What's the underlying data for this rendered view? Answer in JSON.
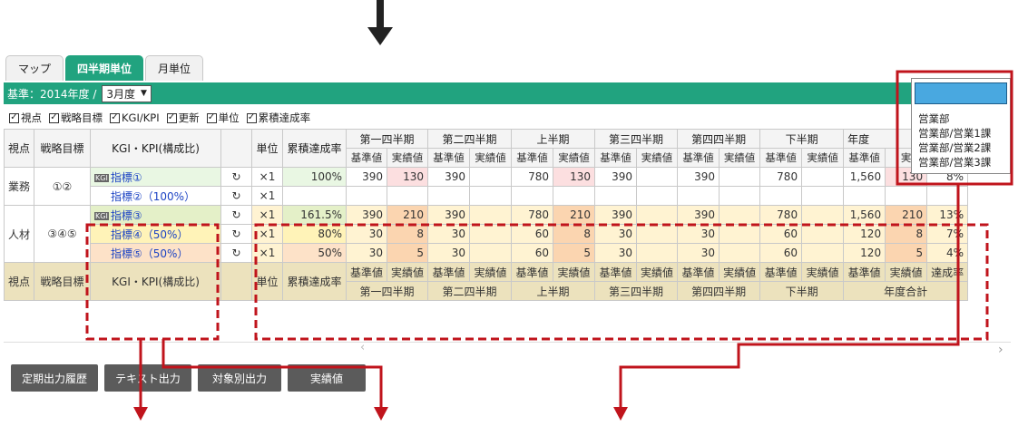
{
  "tabs": [
    {
      "label": "マップ",
      "active": false
    },
    {
      "label": "四半期単位",
      "active": true
    },
    {
      "label": "月単位",
      "active": false
    }
  ],
  "basis": {
    "label": "基準：2014年度 /",
    "select_value": "3月度"
  },
  "checkboxes": [
    "視点",
    "戦略目標",
    "KGI/KPI",
    "更新",
    "単位",
    "累積達成率"
  ],
  "table": {
    "h_viewpoint": "視点",
    "h_goal": "戦略目標",
    "h_kgi": "KGI・KPI(構成比)",
    "h_unit": "単位",
    "h_cum": "累積達成率",
    "periods": [
      "第一四半期",
      "第二四半期",
      "上半期",
      "第三四半期",
      "第四四半期",
      "下半期",
      "年度合計"
    ],
    "sub_base": "基準値",
    "sub_actual": "実績値",
    "sub_rate": "達成率",
    "rows": [
      {
        "viewpoint": "業務",
        "goal": "①②",
        "kgi": "指標①",
        "badge": "KGI",
        "unit": "×1",
        "cum": "100%",
        "vals": [
          "390",
          "130",
          "390",
          "",
          "780",
          "130",
          "390",
          "",
          "390",
          "",
          "780",
          "",
          "1,560",
          "130",
          "8%"
        ]
      },
      {
        "viewpoint": "",
        "goal": "",
        "kgi": "指標②（100%）",
        "badge": "",
        "unit": "×1",
        "cum": "",
        "vals": [
          "",
          "",
          "",
          "",
          "",
          "",
          "",
          "",
          "",
          "",
          "",
          "",
          "",
          "",
          ""
        ]
      },
      {
        "viewpoint": "人材",
        "goal": "③④⑤",
        "kgi": "指標③",
        "badge": "KGI",
        "unit": "×1",
        "cum": "161.5%",
        "vals": [
          "390",
          "210",
          "390",
          "",
          "780",
          "210",
          "390",
          "",
          "390",
          "",
          "780",
          "",
          "1,560",
          "210",
          "13%"
        ]
      },
      {
        "viewpoint": "",
        "goal": "",
        "kgi": "指標④（50%）",
        "badge": "",
        "unit": "×1",
        "cum": "80%",
        "vals": [
          "30",
          "8",
          "30",
          "",
          "60",
          "8",
          "30",
          "",
          "30",
          "",
          "60",
          "",
          "120",
          "8",
          "7%"
        ]
      },
      {
        "viewpoint": "",
        "goal": "",
        "kgi": "指標⑤（50%）",
        "badge": "",
        "unit": "×1",
        "cum": "50%",
        "vals": [
          "30",
          "5",
          "30",
          "",
          "60",
          "5",
          "30",
          "",
          "30",
          "",
          "60",
          "",
          "120",
          "5",
          "4%"
        ]
      }
    ],
    "year_header_partial": "年度",
    "year_sub_partial": "実"
  },
  "dropdown": {
    "options": [
      "営業部",
      "営業部/営業1課",
      "営業部/営業2課",
      "営業部/営業3課"
    ]
  },
  "buttons": [
    "定期出力履歴",
    "テキスト出力",
    "対象別出力",
    "実績値"
  ],
  "colors": {
    "accent": "#21a37f",
    "annotation": "#c0141c",
    "button": "#5b5b5b"
  },
  "icons": [
    "down-arrow-icon",
    "refresh-icon",
    "chevron-down-icon",
    "scroll-left-icon",
    "scroll-right-icon"
  ]
}
